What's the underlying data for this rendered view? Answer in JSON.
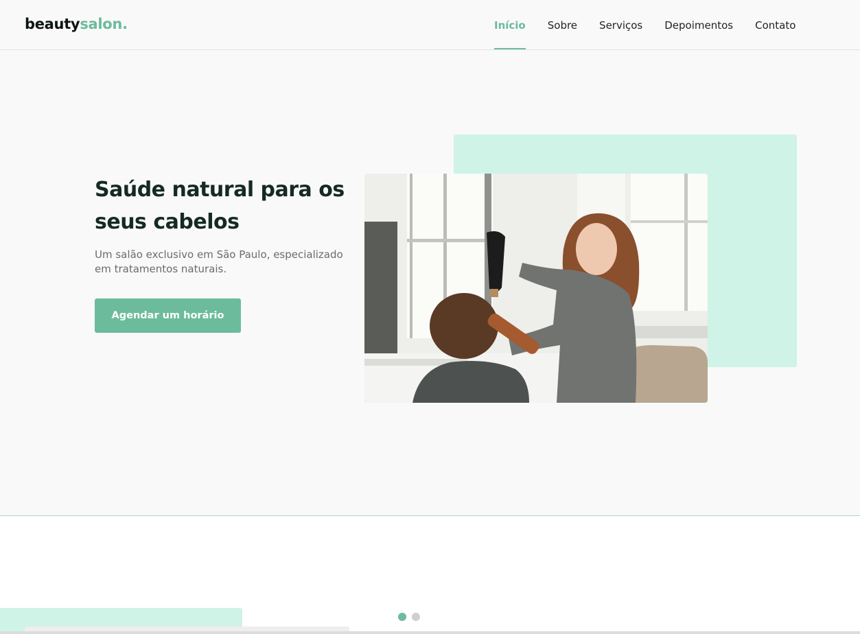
{
  "header": {
    "logo_main": "beauty",
    "logo_accent": "salon.",
    "nav": [
      "Início",
      "Sobre",
      "Serviços",
      "Depoimentos",
      "Contato"
    ],
    "active_nav": "Início"
  },
  "hero": {
    "title": "Saúde natural para os seus cabelos",
    "subtitle": "Um salão exclusivo em São Paulo, especializado em tratamentos naturais.",
    "cta_label": "Agendar um horário",
    "image": "hairdresser-blow-drying-client-photo"
  },
  "slider": {
    "dots": 2,
    "active_dot": 1
  },
  "colors": {
    "accent": "#6cbb9d",
    "mint": "#cff3e6",
    "heading": "#152a22",
    "body_text": "#6b6b6b",
    "background": "#f9f9f9"
  }
}
